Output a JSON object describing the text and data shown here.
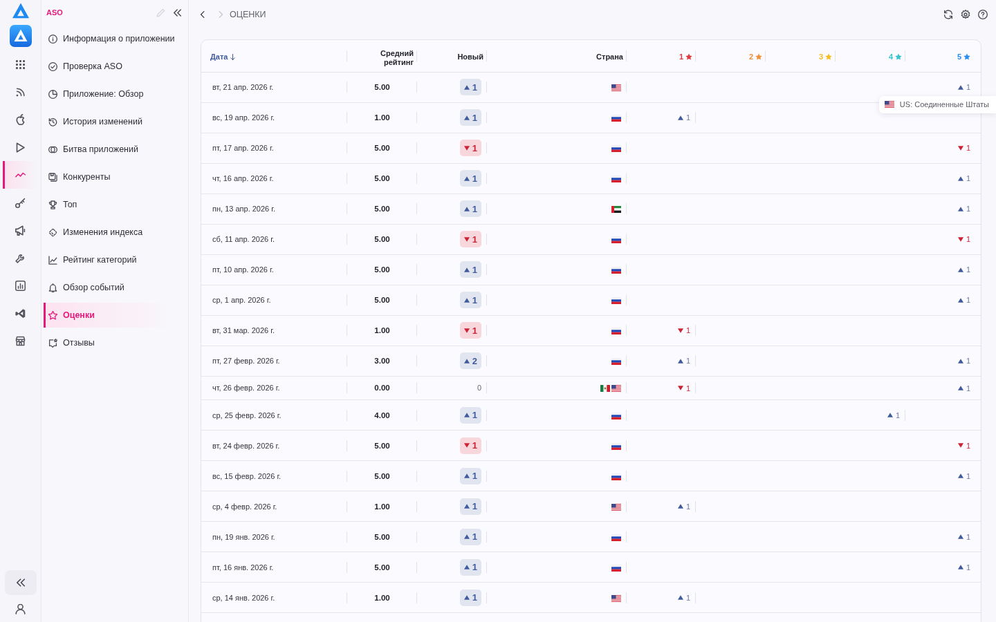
{
  "rail": {
    "items": [
      {
        "selected": false
      },
      {
        "selected": false
      },
      {
        "selected": false
      },
      {
        "selected": false
      },
      {
        "selected": true
      },
      {
        "selected": false
      },
      {
        "selected": false
      },
      {
        "selected": false
      },
      {
        "selected": false
      },
      {
        "selected": false
      },
      {
        "selected": false
      }
    ]
  },
  "sidebar": {
    "title": "ASO",
    "edit_button": {
      "disabled": true
    },
    "items": [
      {
        "label": "Информация о приложении",
        "selected": false
      },
      {
        "label": "Проверка ASO",
        "selected": false
      },
      {
        "label": "Приложение: Обзор",
        "selected": false
      },
      {
        "label": "История изменений",
        "selected": false
      },
      {
        "label": "Битва приложений",
        "selected": false
      },
      {
        "label": "Конкуренты",
        "selected": false
      },
      {
        "label": "Топ",
        "selected": false
      },
      {
        "label": "Изменения индекса",
        "selected": false
      },
      {
        "label": "Рейтинг категорий",
        "selected": false
      },
      {
        "label": "Обзор событий",
        "selected": false
      },
      {
        "label": "Оценки",
        "selected": true
      },
      {
        "label": "Отзывы",
        "selected": false
      }
    ]
  },
  "top_bar": {
    "nav_buttons": [
      {
        "disabled": false
      },
      {
        "disabled": true
      }
    ],
    "breadcrumb": "ОЦЕНКИ"
  },
  "table": {
    "columns": [
      {
        "label": "Дата",
        "kind": "text",
        "sorted": true
      },
      {
        "label": "Средний рейтинг",
        "kind": "text",
        "sorted": false
      },
      {
        "label": "Новый",
        "kind": "text",
        "sorted": false
      },
      {
        "label": "Страна",
        "kind": "text",
        "sorted": false
      },
      {
        "label": "1",
        "kind": "star",
        "color": "#e03b3b",
        "sorted": false
      },
      {
        "label": "2",
        "kind": "star",
        "color": "#f0903a",
        "sorted": false
      },
      {
        "label": "3",
        "kind": "star",
        "color": "#f5bd1f",
        "sorted": false
      },
      {
        "label": "4",
        "kind": "star",
        "color": "#35c4cc",
        "sorted": false
      },
      {
        "label": "5",
        "kind": "star",
        "color": "#2b8ef0",
        "sorted": false
      }
    ],
    "rows": [
      {
        "date": "вт, 21 апр. 2026 г.",
        "average": "5.00",
        "new": {
          "kind": "up",
          "value": "1"
        },
        "countries": [
          {
            "kind": "us"
          }
        ],
        "by_star": [
          {
            "kind": "empty"
          },
          {
            "kind": "empty"
          },
          {
            "kind": "empty"
          },
          {
            "kind": "empty"
          },
          {
            "kind": "up",
            "value": "1"
          }
        ]
      },
      {
        "date": "вс, 19 апр. 2026 г.",
        "average": "1.00",
        "new": {
          "kind": "up",
          "value": "1"
        },
        "countries": [
          {
            "kind": "ru"
          }
        ],
        "by_star": [
          {
            "kind": "up",
            "value": "1"
          },
          {
            "kind": "empty"
          },
          {
            "kind": "empty"
          },
          {
            "kind": "empty"
          },
          {
            "kind": "empty"
          }
        ]
      },
      {
        "date": "пт, 17 апр. 2026 г.",
        "average": "5.00",
        "new": {
          "kind": "down",
          "value": "1"
        },
        "countries": [
          {
            "kind": "ru"
          }
        ],
        "by_star": [
          {
            "kind": "empty"
          },
          {
            "kind": "empty"
          },
          {
            "kind": "empty"
          },
          {
            "kind": "empty"
          },
          {
            "kind": "down",
            "value": "1"
          }
        ]
      },
      {
        "date": "чт, 16 апр. 2026 г.",
        "average": "5.00",
        "new": {
          "kind": "up",
          "value": "1"
        },
        "countries": [
          {
            "kind": "ru"
          }
        ],
        "by_star": [
          {
            "kind": "empty"
          },
          {
            "kind": "empty"
          },
          {
            "kind": "empty"
          },
          {
            "kind": "empty"
          },
          {
            "kind": "up",
            "value": "1"
          }
        ]
      },
      {
        "date": "пн, 13 апр. 2026 г.",
        "average": "5.00",
        "new": {
          "kind": "up",
          "value": "1"
        },
        "countries": [
          {
            "kind": "ae"
          }
        ],
        "by_star": [
          {
            "kind": "empty"
          },
          {
            "kind": "empty"
          },
          {
            "kind": "empty"
          },
          {
            "kind": "empty"
          },
          {
            "kind": "up",
            "value": "1"
          }
        ]
      },
      {
        "date": "сб, 11 апр. 2026 г.",
        "average": "5.00",
        "new": {
          "kind": "down",
          "value": "1"
        },
        "countries": [
          {
            "kind": "ru"
          }
        ],
        "by_star": [
          {
            "kind": "empty"
          },
          {
            "kind": "empty"
          },
          {
            "kind": "empty"
          },
          {
            "kind": "empty"
          },
          {
            "kind": "down",
            "value": "1"
          }
        ]
      },
      {
        "date": "пт, 10 апр. 2026 г.",
        "average": "5.00",
        "new": {
          "kind": "up",
          "value": "1"
        },
        "countries": [
          {
            "kind": "ru"
          }
        ],
        "by_star": [
          {
            "kind": "empty"
          },
          {
            "kind": "empty"
          },
          {
            "kind": "empty"
          },
          {
            "kind": "empty"
          },
          {
            "kind": "up",
            "value": "1"
          }
        ]
      },
      {
        "date": "ср, 1 апр. 2026 г.",
        "average": "5.00",
        "new": {
          "kind": "up",
          "value": "1"
        },
        "countries": [
          {
            "kind": "ru"
          }
        ],
        "by_star": [
          {
            "kind": "empty"
          },
          {
            "kind": "empty"
          },
          {
            "kind": "empty"
          },
          {
            "kind": "empty"
          },
          {
            "kind": "up",
            "value": "1"
          }
        ]
      },
      {
        "date": "вт, 31 мар. 2026 г.",
        "average": "1.00",
        "new": {
          "kind": "down",
          "value": "1"
        },
        "countries": [
          {
            "kind": "ru"
          }
        ],
        "by_star": [
          {
            "kind": "down",
            "value": "1"
          },
          {
            "kind": "empty"
          },
          {
            "kind": "empty"
          },
          {
            "kind": "empty"
          },
          {
            "kind": "empty"
          }
        ]
      },
      {
        "date": "пт, 27 февр. 2026 г.",
        "average": "3.00",
        "new": {
          "kind": "up",
          "value": "2"
        },
        "countries": [
          {
            "kind": "ru"
          }
        ],
        "by_star": [
          {
            "kind": "up",
            "value": "1"
          },
          {
            "kind": "empty"
          },
          {
            "kind": "empty"
          },
          {
            "kind": "empty"
          },
          {
            "kind": "up",
            "value": "1"
          }
        ]
      },
      {
        "date": "чт, 26 февр. 2026 г.",
        "average": "0.00",
        "new": {
          "kind": "plain",
          "value": "0"
        },
        "countries": [
          {
            "kind": "mx"
          },
          {
            "kind": "us"
          }
        ],
        "by_star": [
          {
            "kind": "down",
            "value": "1"
          },
          {
            "kind": "empty"
          },
          {
            "kind": "empty"
          },
          {
            "kind": "empty"
          },
          {
            "kind": "up",
            "value": "1"
          }
        ]
      },
      {
        "date": "ср, 25 февр. 2026 г.",
        "average": "4.00",
        "new": {
          "kind": "up",
          "value": "1"
        },
        "countries": [
          {
            "kind": "ru"
          }
        ],
        "by_star": [
          {
            "kind": "empty"
          },
          {
            "kind": "empty"
          },
          {
            "kind": "empty"
          },
          {
            "kind": "up",
            "value": "1"
          },
          {
            "kind": "empty"
          }
        ]
      },
      {
        "date": "вт, 24 февр. 2026 г.",
        "average": "5.00",
        "new": {
          "kind": "down",
          "value": "1"
        },
        "countries": [
          {
            "kind": "ru"
          }
        ],
        "by_star": [
          {
            "kind": "empty"
          },
          {
            "kind": "empty"
          },
          {
            "kind": "empty"
          },
          {
            "kind": "empty"
          },
          {
            "kind": "down",
            "value": "1"
          }
        ]
      },
      {
        "date": "вс, 15 февр. 2026 г.",
        "average": "5.00",
        "new": {
          "kind": "up",
          "value": "1"
        },
        "countries": [
          {
            "kind": "ru"
          }
        ],
        "by_star": [
          {
            "kind": "empty"
          },
          {
            "kind": "empty"
          },
          {
            "kind": "empty"
          },
          {
            "kind": "empty"
          },
          {
            "kind": "up",
            "value": "1"
          }
        ]
      },
      {
        "date": "ср, 4 февр. 2026 г.",
        "average": "1.00",
        "new": {
          "kind": "up",
          "value": "1"
        },
        "countries": [
          {
            "kind": "us"
          }
        ],
        "by_star": [
          {
            "kind": "up",
            "value": "1"
          },
          {
            "kind": "empty"
          },
          {
            "kind": "empty"
          },
          {
            "kind": "empty"
          },
          {
            "kind": "empty"
          }
        ]
      },
      {
        "date": "пн, 19 янв. 2026 г.",
        "average": "5.00",
        "new": {
          "kind": "up",
          "value": "1"
        },
        "countries": [
          {
            "kind": "ru"
          }
        ],
        "by_star": [
          {
            "kind": "empty"
          },
          {
            "kind": "empty"
          },
          {
            "kind": "empty"
          },
          {
            "kind": "empty"
          },
          {
            "kind": "up",
            "value": "1"
          }
        ]
      },
      {
        "date": "пт, 16 янв. 2026 г.",
        "average": "5.00",
        "new": {
          "kind": "up",
          "value": "1"
        },
        "countries": [
          {
            "kind": "ru"
          }
        ],
        "by_star": [
          {
            "kind": "empty"
          },
          {
            "kind": "empty"
          },
          {
            "kind": "empty"
          },
          {
            "kind": "empty"
          },
          {
            "kind": "up",
            "value": "1"
          }
        ]
      },
      {
        "date": "ср, 14 янв. 2026 г.",
        "average": "1.00",
        "new": {
          "kind": "up",
          "value": "1"
        },
        "countries": [
          {
            "kind": "us"
          }
        ],
        "by_star": [
          {
            "kind": "up",
            "value": "1"
          },
          {
            "kind": "empty"
          },
          {
            "kind": "empty"
          },
          {
            "kind": "empty"
          },
          {
            "kind": "empty"
          }
        ]
      }
    ]
  },
  "tooltip": {
    "flag": {
      "kind": "us"
    },
    "text": "US: Соединенные Штаты"
  }
}
